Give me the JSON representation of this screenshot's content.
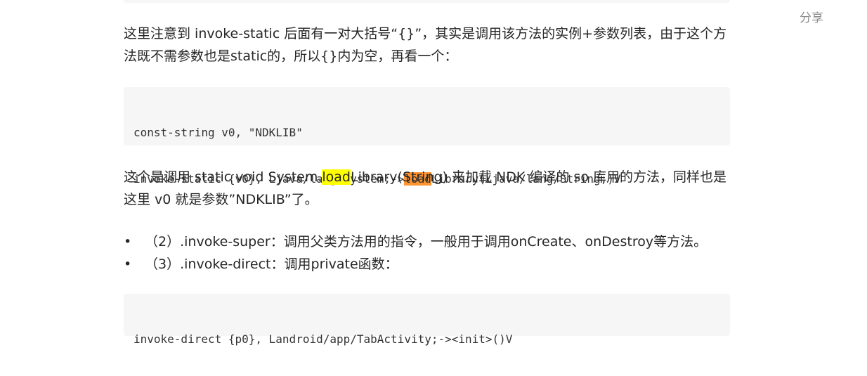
{
  "share_label": "分享",
  "para1": "这里注意到 invoke-static 后面有一对大括号“{}”，其实是调用该方法的实例+参数列表，由于这个方法既不需参数也是static的，所以{}内为空，再看一个：",
  "code1": {
    "line1": "const-string v0, \"NDKLIB\"",
    "line2_before": "invoke-static {v0}, Ljava/lang/System;->",
    "line2_highlight": "load",
    "line2_after": "Library(Ljava/lang/String;)V"
  },
  "para2": {
    "before": "这个是调用 static void System.",
    "highlight": "load",
    "after": "Library(String) 来加载 NDK 编译的 so 库用的方法，同样也是这里 v0 就是参数”NDKLIB”了。"
  },
  "bullets": [
    "（2）.invoke-super：调用父类方法用的指令，一般用于调用onCreate、onDestroy等方法。",
    "（3）.invoke-direct：调用private函数："
  ],
  "code2": {
    "line1": "invoke-direct {p0}, Landroid/app/TabActivity;-><init>()V"
  }
}
